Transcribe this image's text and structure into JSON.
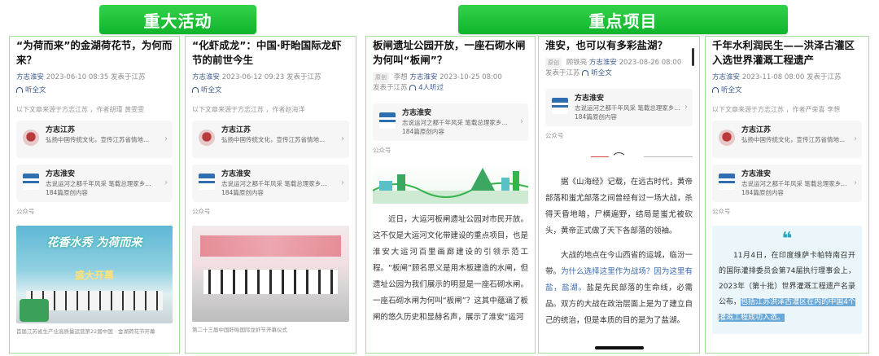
{
  "banners": {
    "left": "重大活动",
    "right": "重点项目"
  },
  "accounts": {
    "jiangsu": {
      "name": "方志江苏",
      "desc": "弘扬中国传统文化，宣传江苏省情地..."
    },
    "huaian": {
      "name": "方志淮安",
      "desc": "志说运河之都千年风采 笔载总理家乡...",
      "count": "184篇原创内容"
    },
    "gzh_label": "公众号"
  },
  "listen_label": "听全文",
  "articles": [
    {
      "title": "“为荷而来”的金湖荷花节，为何而来？",
      "author": "方志淮安",
      "date": "2023-06-10 08:35",
      "location": "发表于江苏",
      "source": "以下文章来源于方志江苏 ，作者胡瑾 黄雯雯",
      "photo_banner": "花香水秀 为荷而来",
      "photo_sign": "盛大开幕",
      "caption": "首届江苏省生产业高质量运营第22届中国 · 金湖荷花节开幕"
    },
    {
      "title": "“化虾成龙”：中国·盱眙国际龙虾节的前世今生",
      "author": "方志淮安",
      "date": "2023-06-12 09:23",
      "location": "发表于江苏",
      "source": "以下文章来源于方志江苏 ，作者赵海洋",
      "caption": "第二十三届中国盱眙国际龙虾节开幕仪式"
    },
    {
      "title": "板闸遗址公园开放，一座石砌水闸为何叫“板闸”？",
      "tag": "原创",
      "writer": "李想",
      "author": "方志淮安",
      "date": "2023-10-25 08:00",
      "location": "发表于江苏",
      "listeners": "4人听过",
      "body": "近日，大运河板闸遗址公园对市民开放。这不仅是大运河文化带建设的重点项目，也是淮安大运河百里画廊建设的引领示范工程。“板闸”顾名思义是用木板建造的水闸，但遗址公园为我们展示的明显是一座石砌水闸。一座石砌水闸为何叫“板闸”？这其中蕴涵了板闸的悠久历史和显赫名声，展示了淮安“运河"
    },
    {
      "title": "淮安，也可以有多彩盐湖？",
      "tag": "原创",
      "writer": "顾铁亮",
      "author": "方志淮安",
      "date": "2023-08-26 08:00",
      "location": "发表于江苏",
      "body1": "据《山海经》记载，在远古时代，黄帝部落和蚩尤部落之间曾经有过一场大战，杀得天昏地暗，尸横遍野，结局是蚩尤被砍头，黄帝正式做了天下各部落的领袖。",
      "body2_a": "大战的地点在今山西省的运城，临汾一带。",
      "body2_link": "为什么选择这里作为战场？因为这里有盐，盐湖。",
      "body2_b": "盐是先民部落的生命线，必需品。双方的大战在政治层面上是为了建立自己的统治，但是本质的目的是为了",
      "body2_tail": "盐湖。"
    },
    {
      "title": "千年水利润民生——洪泽古灌区入选世界灌溉工程遗产",
      "author": "方志淮安",
      "date": "2023-11-08 08:00",
      "location": "发表于江苏",
      "source": "以下文章来源于方志江苏 ，作者严荣喜 李想",
      "quote_a": "11月4日，在印度维萨卡帕特南召开的国际灌排委员会第74届执行理事会上，2023年（第十批）世界灌溉工程遗产名录公布，",
      "quote_hl": "包括江苏洪泽古灌区在内的中国4个灌溉工程成功入选。"
    }
  ]
}
